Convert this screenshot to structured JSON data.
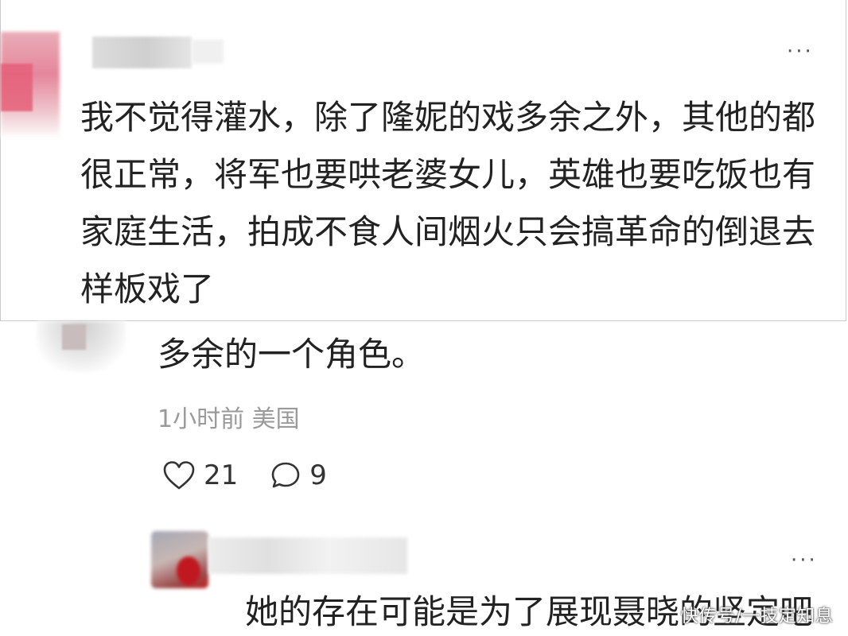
{
  "top_comment": {
    "text": "我不觉得灌水，除了隆妮的戏多余之外，其他的都很正常，将军也要哄老婆女儿，英雄也要吃饭也有家庭生活，拍成不食人间烟火只会搞革命的倒退去样板戏了",
    "more_label": "···"
  },
  "mid_comment": {
    "text": "多余的一个角色。",
    "time": "1小时前",
    "location": "美国",
    "likes": "21",
    "replies": "9"
  },
  "reply_comment": {
    "text": "她的存在可能是为了展现聂晓的坚定吧",
    "more_label": "···"
  },
  "watermark": "快传号/一技定知息",
  "icons": {
    "like": "heart-outline-icon",
    "comment": "speech-bubble-icon",
    "more": "ellipsis-icon"
  },
  "colors": {
    "text": "#222222",
    "meta": "#9a9a9a",
    "card_border": "#c9c9c9"
  }
}
